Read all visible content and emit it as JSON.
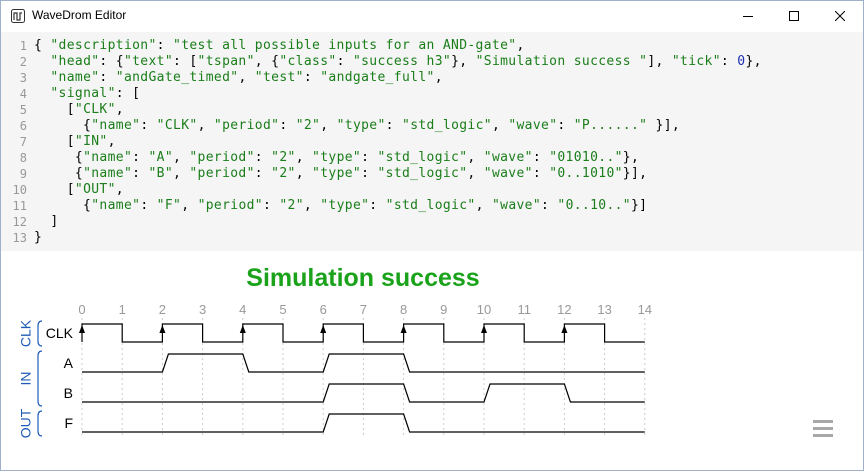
{
  "window": {
    "title": "WaveDrom Editor",
    "controls": {
      "minimize": "minimize-icon",
      "maximize": "maximize-icon",
      "close": "close-icon"
    }
  },
  "editor": {
    "lines": [
      [
        {
          "t": "p",
          "v": "{ "
        },
        {
          "t": "s",
          "v": "\"description\""
        },
        {
          "t": "p",
          "v": ": "
        },
        {
          "t": "s",
          "v": "\"test all possible inputs for an AND-gate\""
        },
        {
          "t": "p",
          "v": ","
        }
      ],
      [
        {
          "t": "p",
          "v": "  "
        },
        {
          "t": "s",
          "v": "\"head\""
        },
        {
          "t": "p",
          "v": ": {"
        },
        {
          "t": "s",
          "v": "\"text\""
        },
        {
          "t": "p",
          "v": ": ["
        },
        {
          "t": "s",
          "v": "\"tspan\""
        },
        {
          "t": "p",
          "v": ", {"
        },
        {
          "t": "s",
          "v": "\"class\""
        },
        {
          "t": "p",
          "v": ": "
        },
        {
          "t": "s",
          "v": "\"success h3\""
        },
        {
          "t": "p",
          "v": "}, "
        },
        {
          "t": "s",
          "v": "\"Simulation success \""
        },
        {
          "t": "p",
          "v": "], "
        },
        {
          "t": "s",
          "v": "\"tick\""
        },
        {
          "t": "p",
          "v": ": "
        },
        {
          "t": "n",
          "v": "0"
        },
        {
          "t": "p",
          "v": "},"
        }
      ],
      [
        {
          "t": "p",
          "v": "  "
        },
        {
          "t": "s",
          "v": "\"name\""
        },
        {
          "t": "p",
          "v": ": "
        },
        {
          "t": "s",
          "v": "\"andGate_timed\""
        },
        {
          "t": "p",
          "v": ", "
        },
        {
          "t": "s",
          "v": "\"test\""
        },
        {
          "t": "p",
          "v": ": "
        },
        {
          "t": "s",
          "v": "\"andgate_full\""
        },
        {
          "t": "p",
          "v": ","
        }
      ],
      [
        {
          "t": "p",
          "v": "  "
        },
        {
          "t": "s",
          "v": "\"signal\""
        },
        {
          "t": "p",
          "v": ": ["
        }
      ],
      [
        {
          "t": "p",
          "v": "    ["
        },
        {
          "t": "s",
          "v": "\"CLK\""
        },
        {
          "t": "p",
          "v": ","
        }
      ],
      [
        {
          "t": "p",
          "v": "      {"
        },
        {
          "t": "s",
          "v": "\"name\""
        },
        {
          "t": "p",
          "v": ": "
        },
        {
          "t": "s",
          "v": "\"CLK\""
        },
        {
          "t": "p",
          "v": ", "
        },
        {
          "t": "s",
          "v": "\"period\""
        },
        {
          "t": "p",
          "v": ": "
        },
        {
          "t": "s",
          "v": "\"2\""
        },
        {
          "t": "p",
          "v": ", "
        },
        {
          "t": "s",
          "v": "\"type\""
        },
        {
          "t": "p",
          "v": ": "
        },
        {
          "t": "s",
          "v": "\"std_logic\""
        },
        {
          "t": "p",
          "v": ", "
        },
        {
          "t": "s",
          "v": "\"wave\""
        },
        {
          "t": "p",
          "v": ": "
        },
        {
          "t": "s",
          "v": "\"P......\""
        },
        {
          "t": "p",
          "v": " }],"
        }
      ],
      [
        {
          "t": "p",
          "v": "    ["
        },
        {
          "t": "s",
          "v": "\"IN\""
        },
        {
          "t": "p",
          "v": ","
        }
      ],
      [
        {
          "t": "p",
          "v": "     {"
        },
        {
          "t": "s",
          "v": "\"name\""
        },
        {
          "t": "p",
          "v": ": "
        },
        {
          "t": "s",
          "v": "\"A\""
        },
        {
          "t": "p",
          "v": ", "
        },
        {
          "t": "s",
          "v": "\"period\""
        },
        {
          "t": "p",
          "v": ": "
        },
        {
          "t": "s",
          "v": "\"2\""
        },
        {
          "t": "p",
          "v": ", "
        },
        {
          "t": "s",
          "v": "\"type\""
        },
        {
          "t": "p",
          "v": ": "
        },
        {
          "t": "s",
          "v": "\"std_logic\""
        },
        {
          "t": "p",
          "v": ", "
        },
        {
          "t": "s",
          "v": "\"wave\""
        },
        {
          "t": "p",
          "v": ": "
        },
        {
          "t": "s",
          "v": "\"01010..\""
        },
        {
          "t": "p",
          "v": "},"
        }
      ],
      [
        {
          "t": "p",
          "v": "     {"
        },
        {
          "t": "s",
          "v": "\"name\""
        },
        {
          "t": "p",
          "v": ": "
        },
        {
          "t": "s",
          "v": "\"B\""
        },
        {
          "t": "p",
          "v": ", "
        },
        {
          "t": "s",
          "v": "\"period\""
        },
        {
          "t": "p",
          "v": ": "
        },
        {
          "t": "s",
          "v": "\"2\""
        },
        {
          "t": "p",
          "v": ", "
        },
        {
          "t": "s",
          "v": "\"type\""
        },
        {
          "t": "p",
          "v": ": "
        },
        {
          "t": "s",
          "v": "\"std_logic\""
        },
        {
          "t": "p",
          "v": ", "
        },
        {
          "t": "s",
          "v": "\"wave\""
        },
        {
          "t": "p",
          "v": ": "
        },
        {
          "t": "s",
          "v": "\"0..1010\""
        },
        {
          "t": "p",
          "v": "}],"
        }
      ],
      [
        {
          "t": "p",
          "v": "    ["
        },
        {
          "t": "s",
          "v": "\"OUT\""
        },
        {
          "t": "p",
          "v": ","
        }
      ],
      [
        {
          "t": "p",
          "v": "      {"
        },
        {
          "t": "s",
          "v": "\"name\""
        },
        {
          "t": "p",
          "v": ": "
        },
        {
          "t": "s",
          "v": "\"F\""
        },
        {
          "t": "p",
          "v": ", "
        },
        {
          "t": "s",
          "v": "\"period\""
        },
        {
          "t": "p",
          "v": ": "
        },
        {
          "t": "s",
          "v": "\"2\""
        },
        {
          "t": "p",
          "v": ", "
        },
        {
          "t": "s",
          "v": "\"type\""
        },
        {
          "t": "p",
          "v": ": "
        },
        {
          "t": "s",
          "v": "\"std_logic\""
        },
        {
          "t": "p",
          "v": ", "
        },
        {
          "t": "s",
          "v": "\"wave\""
        },
        {
          "t": "p",
          "v": ": "
        },
        {
          "t": "s",
          "v": "\"0..10..\""
        },
        {
          "t": "p",
          "v": "}]"
        }
      ],
      [
        {
          "t": "p",
          "v": "  ]"
        }
      ],
      [
        {
          "t": "p",
          "v": "}"
        }
      ]
    ]
  },
  "preview": {
    "title": "Simulation success",
    "title_color": "#1aa31a",
    "ticks": [
      "0",
      "1",
      "2",
      "3",
      "4",
      "5",
      "6",
      "7",
      "8",
      "9",
      "10",
      "11",
      "12",
      "13",
      "14"
    ],
    "groups": [
      {
        "label": "CLK",
        "signals": [
          {
            "name": "CLK",
            "kind": "clock",
            "period": 2
          }
        ]
      },
      {
        "label": "IN",
        "signals": [
          {
            "name": "A",
            "kind": "logic",
            "levels": [
              0,
              1,
              0,
              1,
              0,
              0,
              0
            ]
          },
          {
            "name": "B",
            "kind": "logic",
            "levels": [
              0,
              0,
              0,
              1,
              0,
              1,
              0
            ]
          }
        ]
      },
      {
        "label": "OUT",
        "signals": [
          {
            "name": "F",
            "kind": "logic",
            "levels": [
              0,
              0,
              0,
              1,
              0,
              0,
              0
            ]
          }
        ]
      }
    ],
    "group_color": "#1f5cb8",
    "menu_icon": "hamburger-menu-icon"
  }
}
